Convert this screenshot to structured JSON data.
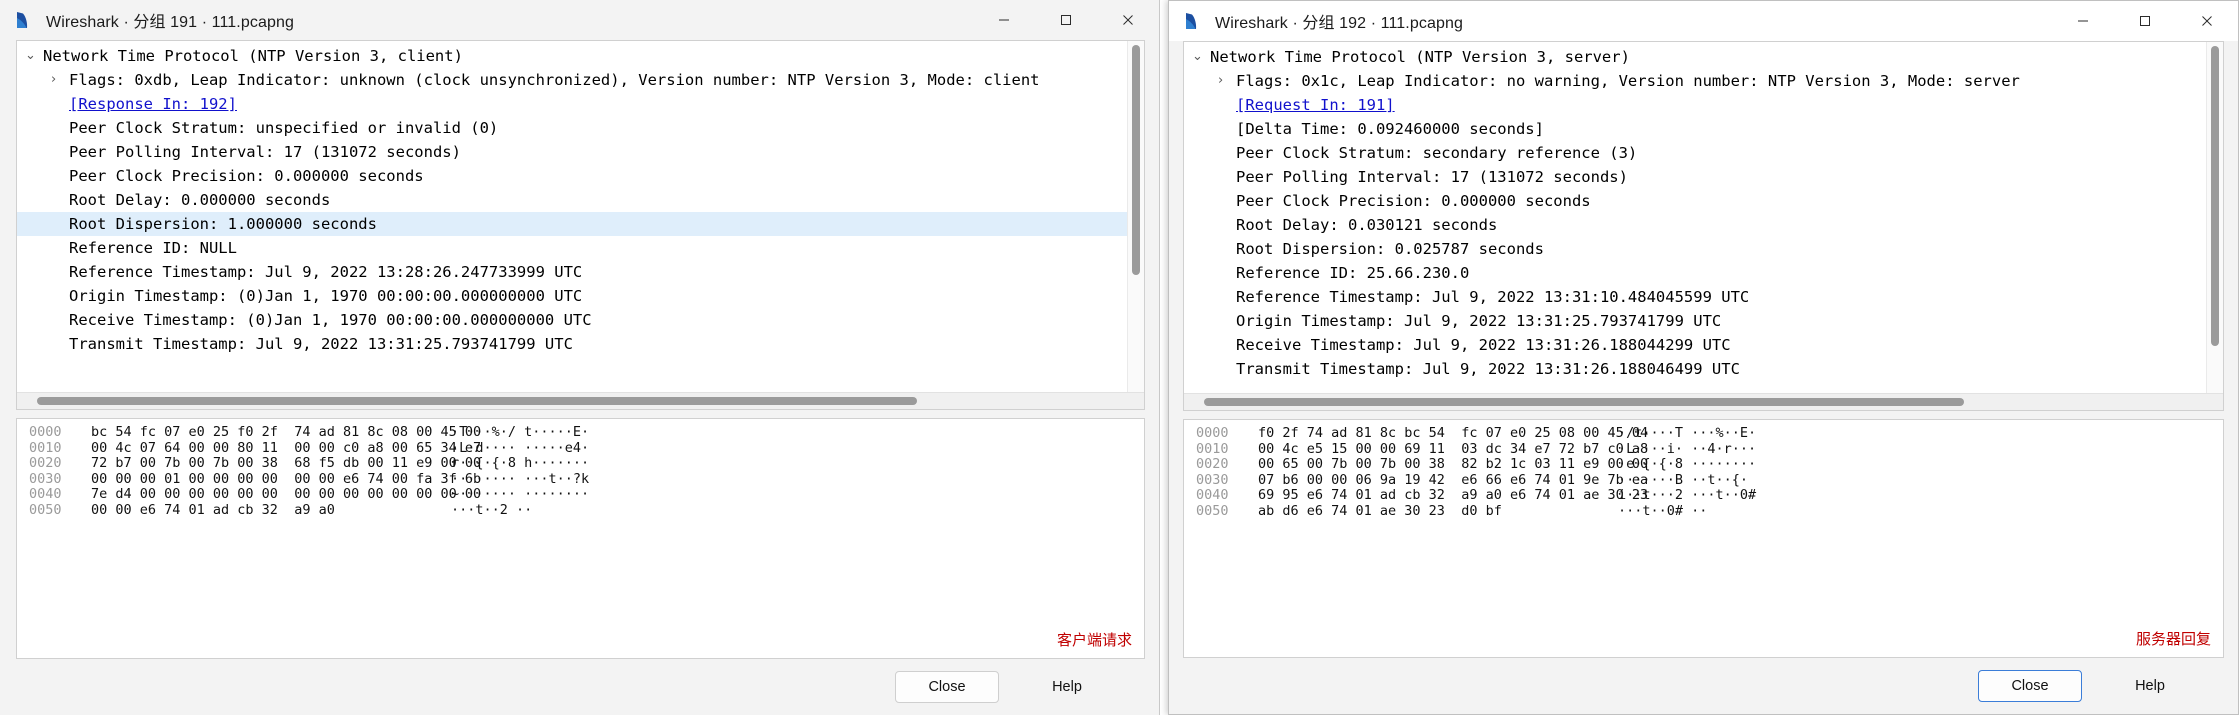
{
  "windows": [
    {
      "id": "left",
      "title": "Wireshark · 分组 191 · 111.pcapng",
      "icon": "wireshark-fin-icon",
      "controls": {
        "minimize": "–",
        "maximize": "□",
        "close": "✕"
      },
      "tree": [
        {
          "indent": 0,
          "twisty": "expanded",
          "text": "Network Time Protocol (NTP Version 3, client)",
          "selected": false,
          "link": false
        },
        {
          "indent": 1,
          "twisty": "collapsed",
          "text": "Flags: 0xdb, Leap Indicator: unknown (clock unsynchronized), Version number: NTP Version 3, Mode: client",
          "selected": false,
          "link": false
        },
        {
          "indent": 1,
          "twisty": "none",
          "text": "[Response In: 192]",
          "selected": false,
          "link": true
        },
        {
          "indent": 1,
          "twisty": "none",
          "text": "Peer Clock Stratum: unspecified or invalid (0)",
          "selected": false,
          "link": false
        },
        {
          "indent": 1,
          "twisty": "none",
          "text": "Peer Polling Interval: 17 (131072 seconds)",
          "selected": false,
          "link": false
        },
        {
          "indent": 1,
          "twisty": "none",
          "text": "Peer Clock Precision: 0.000000 seconds",
          "selected": false,
          "link": false
        },
        {
          "indent": 1,
          "twisty": "none",
          "text": "Root Delay: 0.000000 seconds",
          "selected": false,
          "link": false
        },
        {
          "indent": 1,
          "twisty": "none",
          "text": "Root Dispersion: 1.000000 seconds",
          "selected": true,
          "link": false
        },
        {
          "indent": 1,
          "twisty": "none",
          "text": "Reference ID: NULL",
          "selected": false,
          "link": false
        },
        {
          "indent": 1,
          "twisty": "none",
          "text": "Reference Timestamp: Jul  9, 2022 13:28:26.247733999 UTC",
          "selected": false,
          "link": false
        },
        {
          "indent": 1,
          "twisty": "none",
          "text": "Origin Timestamp: (0)Jan  1, 1970 00:00:00.000000000 UTC",
          "selected": false,
          "link": false
        },
        {
          "indent": 1,
          "twisty": "none",
          "text": "Receive Timestamp: (0)Jan  1, 1970 00:00:00.000000000 UTC",
          "selected": false,
          "link": false
        },
        {
          "indent": 1,
          "twisty": "none",
          "text": "Transmit Timestamp: Jul  9, 2022 13:31:25.793741799 UTC",
          "selected": false,
          "link": false
        }
      ],
      "hex": [
        {
          "offset": "0000",
          "bytes": "bc 54 fc 07 e0 25 f0 2f  74 ad 81 8c 08 00 45 00",
          "ascii": "·T···%·/ t·····E·"
        },
        {
          "offset": "0010",
          "bytes": "00 4c 07 64 00 00 80 11  00 00 c0 a8 00 65 34 e7",
          "ascii": "·L·d···· ·····e4·"
        },
        {
          "offset": "0020",
          "bytes": "72 b7 00 7b 00 7b 00 38  68 f5 db 00 11 e9 00 00",
          "ascii": "r··{·{·8 h·······"
        },
        {
          "offset": "0030",
          "bytes": "00 00 00 01 00 00 00 00  00 00 e6 74 00 fa 3f 6b",
          "ascii": "········ ···t··?k"
        },
        {
          "offset": "0040",
          "bytes": "7e d4 00 00 00 00 00 00  00 00 00 00 00 00 00 00",
          "ascii": "~······· ········"
        },
        {
          "offset": "0050",
          "bytes": "00 00 e6 74 01 ad cb 32  a9 a0",
          "ascii": "···t··2 ··"
        }
      ],
      "annotation": "客户端请求",
      "buttons": {
        "close": "Close",
        "help": "Help"
      }
    },
    {
      "id": "right",
      "title": "Wireshark · 分组 192 · 111.pcapng",
      "icon": "wireshark-fin-icon",
      "controls": {
        "minimize": "–",
        "maximize": "□",
        "close": "✕"
      },
      "tree": [
        {
          "indent": 0,
          "twisty": "expanded",
          "text": "Network Time Protocol (NTP Version 3, server)",
          "selected": false,
          "link": false
        },
        {
          "indent": 1,
          "twisty": "collapsed",
          "text": "Flags: 0x1c, Leap Indicator: no warning, Version number: NTP Version 3, Mode: server",
          "selected": false,
          "link": false
        },
        {
          "indent": 1,
          "twisty": "none",
          "text": "[Request In: 191]",
          "selected": false,
          "link": true
        },
        {
          "indent": 1,
          "twisty": "none",
          "text": "[Delta Time: 0.092460000 seconds]",
          "selected": false,
          "link": false
        },
        {
          "indent": 1,
          "twisty": "none",
          "text": "Peer Clock Stratum: secondary reference (3)",
          "selected": false,
          "link": false
        },
        {
          "indent": 1,
          "twisty": "none",
          "text": "Peer Polling Interval: 17 (131072 seconds)",
          "selected": false,
          "link": false
        },
        {
          "indent": 1,
          "twisty": "none",
          "text": "Peer Clock Precision: 0.000000 seconds",
          "selected": false,
          "link": false
        },
        {
          "indent": 1,
          "twisty": "none",
          "text": "Root Delay: 0.030121 seconds",
          "selected": false,
          "link": false
        },
        {
          "indent": 1,
          "twisty": "none",
          "text": "Root Dispersion: 0.025787 seconds",
          "selected": false,
          "link": false
        },
        {
          "indent": 1,
          "twisty": "none",
          "text": "Reference ID: 25.66.230.0",
          "selected": false,
          "link": false
        },
        {
          "indent": 1,
          "twisty": "none",
          "text": "Reference Timestamp: Jul  9, 2022 13:31:10.484045599 UTC",
          "selected": false,
          "link": false
        },
        {
          "indent": 1,
          "twisty": "none",
          "text": "Origin Timestamp: Jul  9, 2022 13:31:25.793741799 UTC",
          "selected": false,
          "link": false
        },
        {
          "indent": 1,
          "twisty": "none",
          "text": "Receive Timestamp: Jul  9, 2022 13:31:26.188044299 UTC",
          "selected": false,
          "link": false
        },
        {
          "indent": 1,
          "twisty": "none",
          "text": "Transmit Timestamp: Jul  9, 2022 13:31:26.188046499 UTC",
          "selected": false,
          "link": false
        }
      ],
      "hex": [
        {
          "offset": "0000",
          "bytes": "f0 2f 74 ad 81 8c bc 54  fc 07 e0 25 08 00 45 04",
          "ascii": "·/t····T ···%··E·"
        },
        {
          "offset": "0010",
          "bytes": "00 4c e5 15 00 00 69 11  03 dc 34 e7 72 b7 c0 a8",
          "ascii": "·L····i· ··4·r···"
        },
        {
          "offset": "0020",
          "bytes": "00 65 00 7b 00 7b 00 38  82 b2 1c 03 11 e9 00 00",
          "ascii": "·e·{·{·8 ········"
        },
        {
          "offset": "0030",
          "bytes": "07 b6 00 00 06 9a 19 42  e6 66 e6 74 01 9e 7b ea",
          "ascii": "·······B ··t··{·"
        },
        {
          "offset": "0040",
          "bytes": "69 95 e6 74 01 ad cb 32  a9 a0 e6 74 01 ae 30 23",
          "ascii": "i··t···2 ···t··0#"
        },
        {
          "offset": "0050",
          "bytes": "ab d6 e6 74 01 ae 30 23  d0 bf",
          "ascii": "···t··0# ··"
        }
      ],
      "annotation": "服务器回复",
      "buttons": {
        "close": "Close",
        "help": "Help"
      }
    }
  ],
  "colors": {
    "selection": "#dfeefb",
    "link": "#1111cc",
    "annotation": "#c00000",
    "default_button_border": "#3b7dd8"
  }
}
